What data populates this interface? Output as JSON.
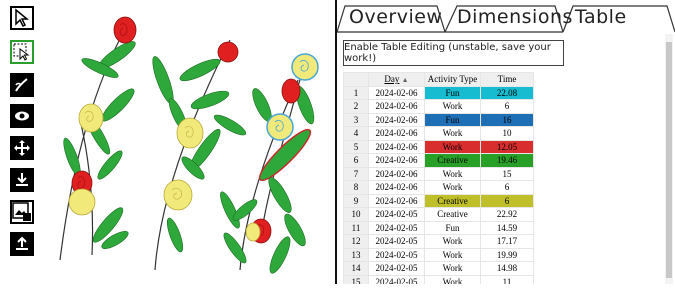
{
  "toolbar": {
    "tools": [
      {
        "name": "select-tool",
        "icon": "cursor-icon",
        "active": false
      },
      {
        "name": "lasso-select-tool",
        "icon": "box-select-icon",
        "active": true
      },
      {
        "name": "draw-tool",
        "icon": "brush-icon",
        "active": false
      },
      {
        "name": "view-tool",
        "icon": "eye-icon",
        "active": false
      },
      {
        "name": "move-tool",
        "icon": "move-arrows-icon",
        "active": false
      },
      {
        "name": "download-tool",
        "icon": "download-icon",
        "active": false
      },
      {
        "name": "image-tool",
        "icon": "image-icon",
        "active": false
      },
      {
        "name": "upload-tool",
        "icon": "upload-icon",
        "active": false
      }
    ]
  },
  "tabs": {
    "overview": "Overview",
    "dimensions": "Dimensions",
    "table": "Table"
  },
  "panel": {
    "edit_button": "Enable Table Editing (unstable, save your work!)",
    "table": {
      "headers": {
        "day": "Day",
        "type": "Activity Type",
        "time": "Time"
      },
      "rows": [
        {
          "idx": "1",
          "day": "2024-02-06",
          "type": "Fun",
          "time": "22.08",
          "color": "#17bcd0"
        },
        {
          "idx": "2",
          "day": "2024-02-06",
          "type": "Work",
          "time": "6",
          "color": ""
        },
        {
          "idx": "3",
          "day": "2024-02-06",
          "type": "Fun",
          "time": "16",
          "color": "#1f6fb6"
        },
        {
          "idx": "4",
          "day": "2024-02-06",
          "type": "Work",
          "time": "10",
          "color": ""
        },
        {
          "idx": "5",
          "day": "2024-02-06",
          "type": "Work",
          "time": "12.05",
          "color": "#d92e2e"
        },
        {
          "idx": "6",
          "day": "2024-02-06",
          "type": "Creative",
          "time": "19.46",
          "color": "#28a028"
        },
        {
          "idx": "7",
          "day": "2024-02-06",
          "type": "Work",
          "time": "15",
          "color": ""
        },
        {
          "idx": "8",
          "day": "2024-02-06",
          "type": "Work",
          "time": "6",
          "color": ""
        },
        {
          "idx": "9",
          "day": "2024-02-06",
          "type": "Creative",
          "time": "6",
          "color": "#bfbf2a"
        },
        {
          "idx": "10",
          "day": "2024-02-05",
          "type": "Creative",
          "time": "22.92",
          "color": ""
        },
        {
          "idx": "11",
          "day": "2024-02-05",
          "type": "Fun",
          "time": "14.59",
          "color": ""
        },
        {
          "idx": "12",
          "day": "2024-02-05",
          "type": "Work",
          "time": "17.17",
          "color": ""
        },
        {
          "idx": "13",
          "day": "2024-02-05",
          "type": "Work",
          "time": "19.99",
          "color": ""
        },
        {
          "idx": "14",
          "day": "2024-02-05",
          "type": "Work",
          "time": "14.98",
          "color": ""
        },
        {
          "idx": "15",
          "day": "2024-02-05",
          "type": "Work",
          "time": "11",
          "color": ""
        }
      ]
    }
  },
  "colors": {
    "leaf": "#2ea83a",
    "rose_red": "#e02020",
    "rose_yellow": "#f1ea7a",
    "rose_blue_outline": "#4aa6d6",
    "active_tool_border": "#2a9d2a"
  }
}
